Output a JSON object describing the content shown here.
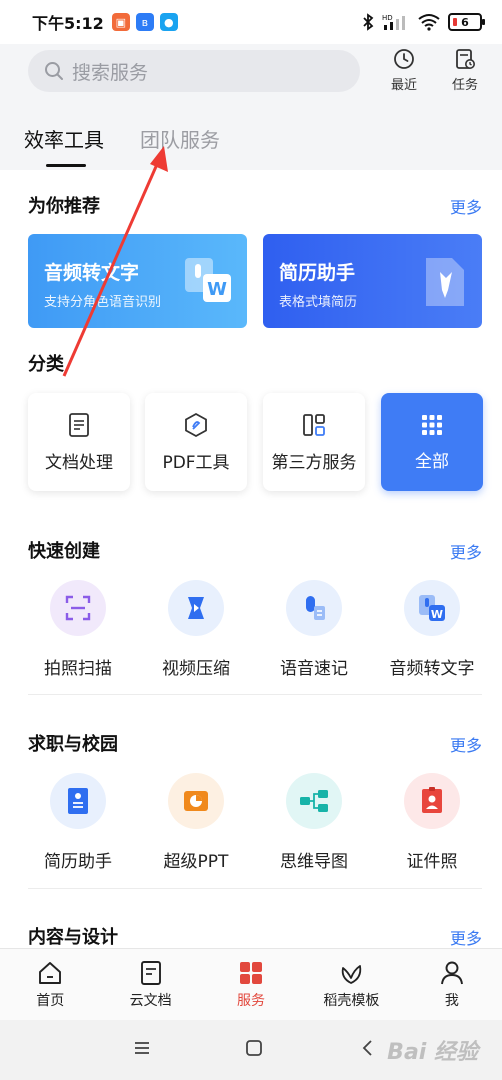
{
  "status_bar": {
    "time": "下午5:12",
    "battery": "6"
  },
  "header": {
    "search_placeholder": "搜索服务",
    "actions": [
      {
        "label": "最近",
        "icon": "clock-icon"
      },
      {
        "label": "任务",
        "icon": "task-icon"
      }
    ],
    "tabs": [
      {
        "label": "效率工具",
        "active": true
      },
      {
        "label": "团队服务",
        "active": false
      }
    ]
  },
  "recommend": {
    "title": "为你推荐",
    "more": "更多",
    "banners": [
      {
        "title": "音频转文字",
        "subtitle": "支持分角色语音识别",
        "color": "#4aa3f7"
      },
      {
        "title": "简历助手",
        "subtitle": "表格式填简历",
        "color": "#3567f0"
      }
    ]
  },
  "category": {
    "title": "分类",
    "items": [
      {
        "label": "文档处理",
        "icon": "document-icon"
      },
      {
        "label": "PDF工具",
        "icon": "pdf-icon"
      },
      {
        "label": "第三方服务",
        "icon": "grid-layout-icon"
      },
      {
        "label": "全部",
        "icon": "dots-grid-icon"
      }
    ]
  },
  "quick_create": {
    "title": "快速创建",
    "more": "更多",
    "items": [
      {
        "label": "拍照扫描",
        "icon": "scan-icon",
        "bg": "#f1e9fb"
      },
      {
        "label": "视频压缩",
        "icon": "video-compress-icon",
        "bg": "#e8f0fd"
      },
      {
        "label": "语音速记",
        "icon": "voice-memo-icon",
        "bg": "#e8f0fd"
      },
      {
        "label": "音频转文字",
        "icon": "audio-to-text-icon",
        "bg": "#e8f0fd"
      }
    ]
  },
  "career": {
    "title": "求职与校园",
    "more": "更多",
    "items": [
      {
        "label": "简历助手",
        "icon": "resume-icon",
        "bg": "#e8f0fd"
      },
      {
        "label": "超级PPT",
        "icon": "ppt-icon",
        "bg": "#fdf0e2"
      },
      {
        "label": "思维导图",
        "icon": "mindmap-icon",
        "bg": "#e1f6f5"
      },
      {
        "label": "证件照",
        "icon": "id-photo-icon",
        "bg": "#fde8e8"
      }
    ]
  },
  "content_design": {
    "title": "内容与设计",
    "more": "更多"
  },
  "bottom_nav": [
    {
      "label": "首页",
      "icon": "home-icon",
      "active": false
    },
    {
      "label": "云文档",
      "icon": "cloud-doc-icon",
      "active": false
    },
    {
      "label": "服务",
      "icon": "services-icon",
      "active": true
    },
    {
      "label": "稻壳模板",
      "icon": "leaf-icon",
      "active": false
    },
    {
      "label": "我",
      "icon": "user-icon",
      "active": false
    }
  ],
  "watermark": "Bai 经验",
  "colors": {
    "accent": "#3f7cf5",
    "active_nav": "#e2483d",
    "link": "#3a7af2"
  }
}
